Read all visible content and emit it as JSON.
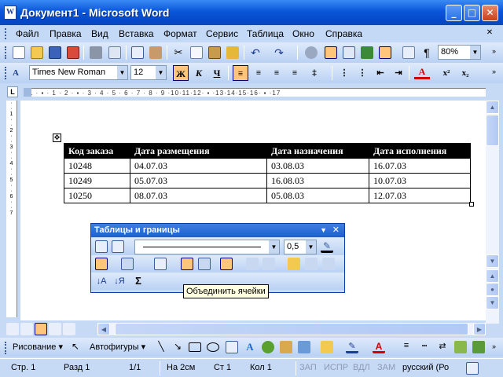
{
  "window": {
    "title": "Документ1 - Microsoft Word",
    "icon_letter": "W"
  },
  "menu": [
    "Файл",
    "Правка",
    "Вид",
    "Вставка",
    "Формат",
    "Сервис",
    "Таблица",
    "Окно",
    "Справка"
  ],
  "toolbar_standard": {
    "zoom": "80%"
  },
  "toolbar_format": {
    "font": "Times New Roman",
    "size": "12",
    "bold": "Ж",
    "italic": "К",
    "underline": "Ч"
  },
  "table": {
    "headers": [
      "Код заказа",
      "Дата размещения",
      "Дата назначения",
      "Дата исполнения"
    ],
    "rows": [
      [
        "10248",
        "04.07.03",
        "03.08.03",
        "16.07.03"
      ],
      [
        "10249",
        "05.07.03",
        "16.08.03",
        "10.07.03"
      ],
      [
        "10250",
        "08.07.03",
        "05.08.03",
        "12.07.03"
      ]
    ]
  },
  "tables_toolbar": {
    "title": "Таблицы и границы",
    "line_weight": "0,5",
    "tooltip": "Объединить ячейки",
    "sum_symbol": "Σ"
  },
  "drawbar": {
    "draw": "Рисование",
    "autoshapes": "Автофигуры"
  },
  "status": {
    "page": "Стр. 1",
    "section": "Разд 1",
    "pages": "1/1",
    "position": "На 2см",
    "line": "Ст 1",
    "column": "Кол 1",
    "rec": "ЗАП",
    "trk": "ИСПР",
    "ext": "ВДЛ",
    "ovr": "ЗАМ",
    "lang": "русский (Ро"
  },
  "colors": {
    "accent": "#0a56d8",
    "panel": "#c4d9f6",
    "highlight": "#ffc57a"
  }
}
